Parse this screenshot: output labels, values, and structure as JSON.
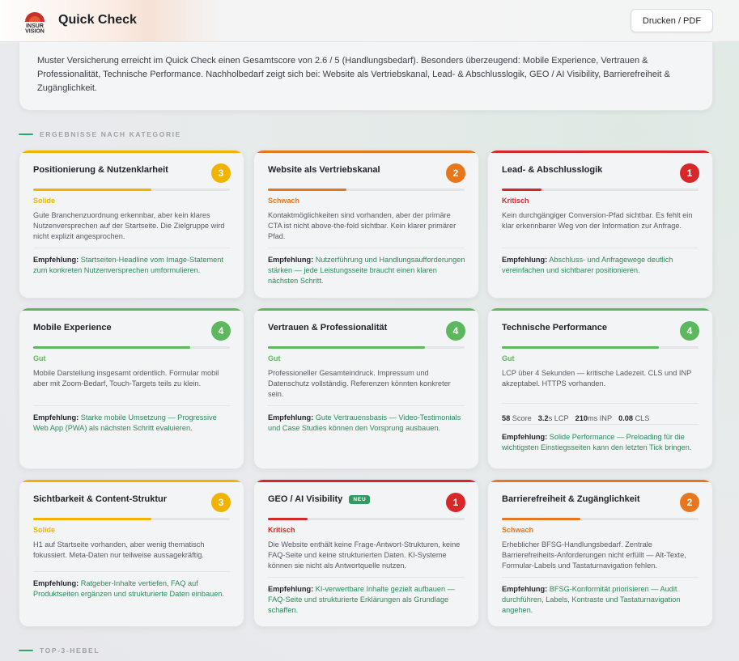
{
  "header": {
    "logo_text": "INSUR VISION",
    "title": "Quick Check",
    "print_label": "Drucken / PDF"
  },
  "summary": {
    "text": "Muster Versicherung erreicht im Quick Check einen Gesamtscore von 2.6 / 5 (Handlungsbedarf). Besonders überzeugend: Mobile Experience, Vertrauen & Professionalität, Technische Performance. Nachholbedarf zeigt sich bei: Website als Vertriebskanal, Lead- & Abschlusslogik, GEO / AI Visibility, Barrierefreiheit & Zugänglichkeit."
  },
  "sections": {
    "results_heading": "ERGEBNISSE NACH KATEGORIE",
    "top3_heading": "TOP-3-HEBEL"
  },
  "colors": {
    "green": "#5cb85c",
    "yellow": "#f0b400",
    "orange": "#e8761c",
    "red": "#d62828",
    "rec_text": "#2b8a57"
  },
  "rec_label": "Empfehlung:",
  "categories": [
    {
      "title": "Positionierung & Nutzenklarheit",
      "score": "3",
      "status": "Solide",
      "level": "yellow",
      "progress": 0.6,
      "description": "Gute Branchenzuordnung erkennbar, aber kein klares Nutzenversprechen auf der Startseite. Die Zielgruppe wird nicht explizit angesprochen.",
      "recommendation": "Startseiten-Headline vom Image-Statement zum konkreten Nutzenversprechen umformulieren."
    },
    {
      "title": "Website als Vertriebskanal",
      "score": "2",
      "status": "Schwach",
      "level": "orange",
      "progress": 0.4,
      "description": "Kontaktmöglichkeiten sind vorhanden, aber der primäre CTA ist nicht above-the-fold sichtbar. Kein klarer primärer Pfad.",
      "recommendation": "Nutzerführung und Handlungsaufforderungen stärken — jede Leistungsseite braucht einen klaren nächsten Schritt."
    },
    {
      "title": "Lead- & Abschlusslogik",
      "score": "1",
      "status": "Kritisch",
      "level": "red",
      "progress": 0.2,
      "description": "Kein durchgängiger Conversion-Pfad sichtbar. Es fehlt ein klar erkennbarer Weg von der Information zur Anfrage.",
      "recommendation": "Abschluss- und Anfragewege deutlich vereinfachen und sichtbarer positionieren."
    },
    {
      "title": "Mobile Experience",
      "score": "4",
      "status": "Gut",
      "level": "green",
      "progress": 0.8,
      "description": "Mobile Darstellung insgesamt ordentlich. Formular mobil aber mit Zoom-Bedarf, Touch-Targets teils zu klein.",
      "recommendation": "Starke mobile Umsetzung — Progressive Web App (PWA) als nächsten Schritt evaluieren."
    },
    {
      "title": "Vertrauen & Professionalität",
      "score": "4",
      "status": "Gut",
      "level": "green",
      "progress": 0.8,
      "description": "Professioneller Gesamteindruck. Impressum und Datenschutz vollständig. Referenzen könnten konkreter sein.",
      "recommendation": "Gute Vertrauensbasis — Video-Testimonials und Case Studies können den Vorsprung ausbauen."
    },
    {
      "title": "Technische Performance",
      "score": "4",
      "status": "Gut",
      "level": "green",
      "progress": 0.8,
      "description": "LCP über 4 Sekunden — kritische Ladezeit. CLS und INP akzeptabel. HTTPS vorhanden.",
      "metrics": [
        {
          "value": "58",
          "unit": " Score"
        },
        {
          "value": "3.2",
          "unit": "s LCP"
        },
        {
          "value": "210",
          "unit": "ms INP"
        },
        {
          "value": "0.08",
          "unit": " CLS"
        }
      ],
      "recommendation": "Solide Performance — Preloading für die wichtigsten Einstiegsseiten kann den letzten Tick bringen."
    },
    {
      "title": "Sichtbarkeit & Content-Struktur",
      "score": "3",
      "status": "Solide",
      "level": "yellow",
      "progress": 0.6,
      "description": "H1 auf Startseite vorhanden, aber wenig thematisch fokussiert. Meta-Daten nur teilweise aussagekräftig.",
      "recommendation": "Ratgeber-Inhalte vertiefen, FAQ auf Produktseiten ergänzen und strukturierte Daten einbauen."
    },
    {
      "title": "GEO / AI Visibility",
      "badge": "NEU",
      "score": "1",
      "status": "Kritisch",
      "level": "red",
      "progress": 0.2,
      "description": "Die Website enthält keine Frage-Antwort-Strukturen, keine FAQ-Seite und keine strukturierten Daten. KI-Systeme können sie nicht als Antwortquelle nutzen.",
      "recommendation": "KI-verwertbare Inhalte gezielt aufbauen — FAQ-Seite und strukturierte Erklärungen als Grundlage schaffen."
    },
    {
      "title": "Barrierefreiheit & Zugänglichkeit",
      "score": "2",
      "status": "Schwach",
      "level": "orange",
      "progress": 0.4,
      "description": "Erheblicher BFSG-Handlungsbedarf. Zentrale Barrierefreiheits-Anforderungen nicht erfüllt — Alt-Texte, Formular-Labels und Tastaturnavigation fehlen.",
      "recommendation": "BFSG-Konformität priorisieren — Audit durchführen, Labels, Kontraste und Tastaturnavigation angehen."
    }
  ]
}
